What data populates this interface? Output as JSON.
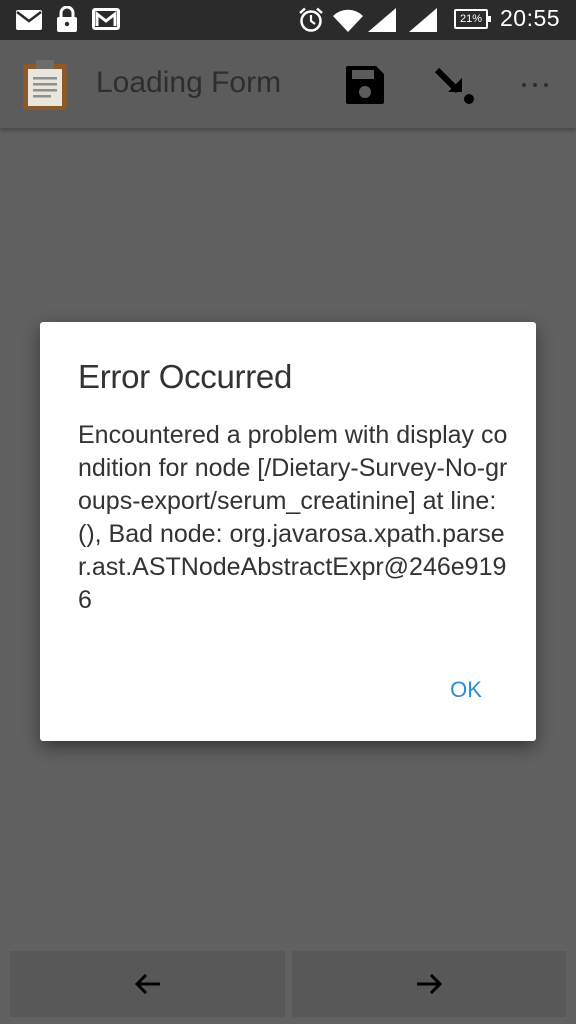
{
  "status_bar": {
    "battery": "21%",
    "time": "20:55",
    "icons": [
      "email-icon",
      "lock-icon",
      "gmail-icon",
      "alarm-icon",
      "wifi-icon",
      "signal-icon",
      "signal-icon-2",
      "battery-icon"
    ]
  },
  "app_bar": {
    "title": "Loading Form",
    "icons": [
      "form-clipboard-icon",
      "save-icon",
      "jump-to-icon",
      "overflow-menu-icon"
    ]
  },
  "dialog": {
    "title": "Error Occurred",
    "message": "Encountered a problem with display condition for node [/Dietary-Survey-No-groups-export/serum_creatinine] at line: (), Bad node: org.javarosa.xpath.parser.ast.ASTNodeAbstractExpr@246e9196",
    "ok_label": "OK",
    "ok_color": "#2b8ed0"
  },
  "navigation": {
    "prev_icon": "arrow-left-icon",
    "next_icon": "arrow-right-icon"
  }
}
